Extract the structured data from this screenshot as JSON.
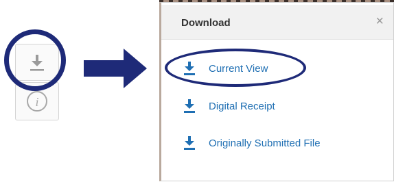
{
  "toolbar": {
    "download_icon": "download-icon",
    "info_icon": "info-icon"
  },
  "dialog": {
    "title": "Download",
    "close": "×",
    "items": [
      {
        "label": "Current View",
        "icon": "download-icon"
      },
      {
        "label": "Digital Receipt",
        "icon": "download-icon"
      },
      {
        "label": "Originally Submitted File",
        "icon": "download-icon"
      }
    ]
  },
  "colors": {
    "accent_blue": "#1f6fb3",
    "highlight_navy": "#1e2a78"
  }
}
